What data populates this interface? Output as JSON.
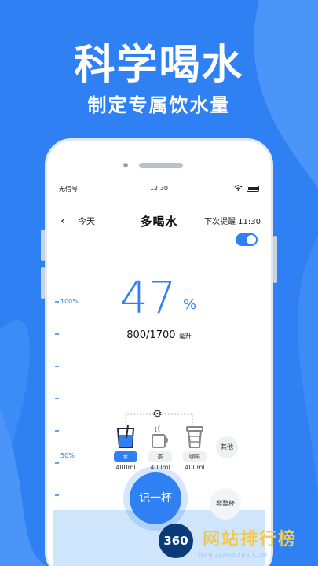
{
  "promo": {
    "headline": "科学喝水",
    "subheadline": "制定专属饮水量"
  },
  "status_bar": {
    "carrier": "无信号",
    "time": "12:30"
  },
  "nav": {
    "back_icon": "chevron-left-icon",
    "left_label": "今天",
    "title": "多喝水",
    "reminder_label": "下次提醒 11:30"
  },
  "reminder_toggle": {
    "on": true
  },
  "scale": {
    "top_label": "100%",
    "mid_label": "50%"
  },
  "progress": {
    "percent_value": "47",
    "percent_sign": "%",
    "amount": "800/1700",
    "unit": "毫升",
    "fill_fraction": 0.47
  },
  "drinks": [
    {
      "name": "水",
      "ml": "400ml",
      "icon": "water-glass-icon",
      "active": true
    },
    {
      "name": "茶",
      "ml": "400ml",
      "icon": "tea-cup-icon",
      "active": false
    },
    {
      "name": "咖啡",
      "ml": "400ml",
      "icon": "coffee-cup-icon",
      "active": false
    }
  ],
  "other_label": "其他",
  "settings_icon": "gear-icon",
  "actions": {
    "record_label": "记一杯",
    "partial_label": "非整杯"
  },
  "watermark": {
    "badge": "360",
    "text": "网站排行榜",
    "sub": "WANGZHAN360.COM"
  },
  "colors": {
    "brand_blue": "#2f80f3",
    "water_fill": "#cfe5fb"
  }
}
